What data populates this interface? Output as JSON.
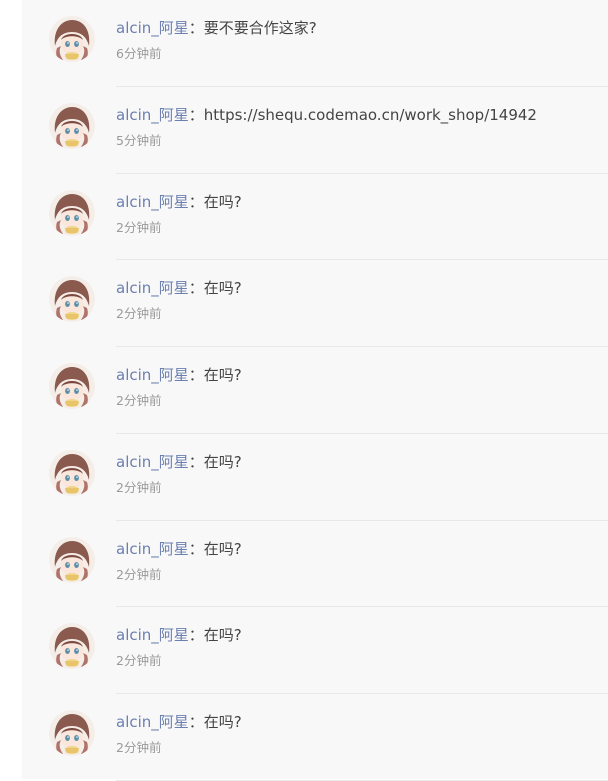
{
  "colors": {
    "username": "#6b7fb0",
    "text": "#444444",
    "time": "#9a9a9a",
    "panel_bg": "#f8f8f8",
    "divider": "#e8e8e8"
  },
  "avatar_icon": "anime-girl-avatar",
  "separator": "：",
  "messages": [
    {
      "user": "alcin_阿星",
      "text": "要不要合作这家?",
      "time": "6分钟前"
    },
    {
      "user": "alcin_阿星",
      "text": "https://shequ.codemao.cn/work_shop/14942",
      "time": "5分钟前"
    },
    {
      "user": "alcin_阿星",
      "text": "在吗?",
      "time": "2分钟前"
    },
    {
      "user": "alcin_阿星",
      "text": "在吗?",
      "time": "2分钟前"
    },
    {
      "user": "alcin_阿星",
      "text": "在吗?",
      "time": "2分钟前"
    },
    {
      "user": "alcin_阿星",
      "text": "在吗?",
      "time": "2分钟前"
    },
    {
      "user": "alcin_阿星",
      "text": "在吗?",
      "time": "2分钟前"
    },
    {
      "user": "alcin_阿星",
      "text": "在吗?",
      "time": "2分钟前"
    },
    {
      "user": "alcin_阿星",
      "text": "在吗?",
      "time": "2分钟前"
    }
  ]
}
